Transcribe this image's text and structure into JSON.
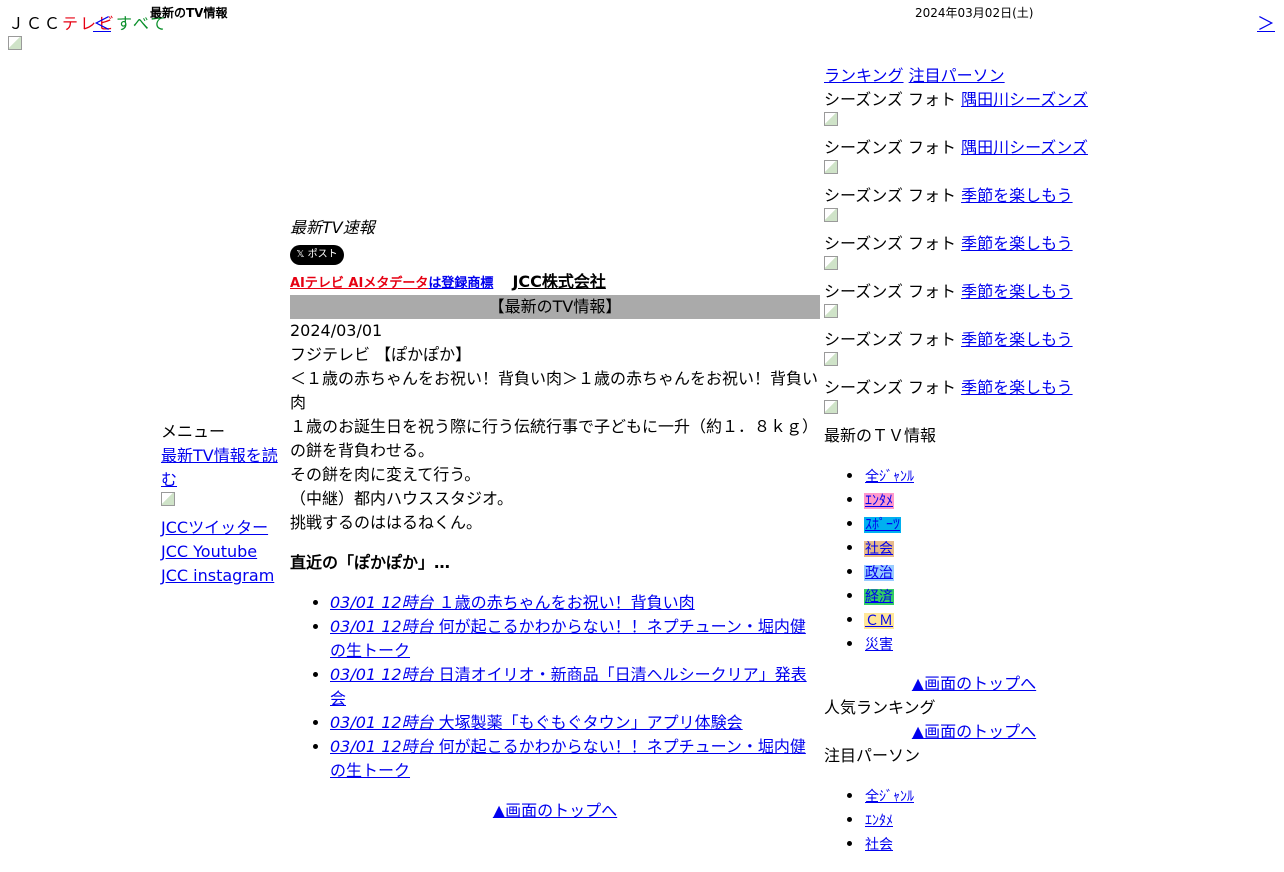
{
  "header": {
    "brand_prefix": "ＪＣＣ",
    "brand_tv": "テレビ",
    "brand_all": "すべて",
    "prev_arrow": "＜",
    "small_title": "最新のTV情報",
    "date": "2024年03月02日(土)",
    "next_arrow": "＞"
  },
  "menu": {
    "title": "メニュー",
    "read_latest": "最新TV情報を読む",
    "twitter": "JCCツイッター",
    "youtube": "JCC Youtube",
    "instagram": "JCC instagram"
  },
  "main": {
    "sokuho": "最新TV速報",
    "tweet": "𝕏 ポスト",
    "registered_red": "AIテレビ AIメタデータ",
    "registered_blue": "は登録商標",
    "company": "JCC株式会社",
    "bar_title": "【最新のTV情報】",
    "date": "2024/03/01",
    "program": "フジテレビ 【ぽかぽか】",
    "headline": "＜１歳の赤ちゃんをお祝い！背負い肉＞１歳の赤ちゃんをお祝い！背負い肉",
    "body1": "１歳のお誕生日を祝う際に行う伝統行事で子どもに一升（約１．８ｋｇ）の餅を背負わせる。",
    "body2": "その餅を肉に変えて行う。",
    "body3": "（中継）都内ハウススタジオ。",
    "body4": "挑戦するのははるねくん。",
    "recent_title": "直近の「ぽかぽか」…",
    "recent": [
      {
        "time": "03/01 12時台",
        "title": " １歳の赤ちゃんをお祝い！背負い肉"
      },
      {
        "time": "03/01 12時台",
        "title": " 何が起こるかわからない！！ネプチューン・堀内健の生トーク"
      },
      {
        "time": "03/01 12時台",
        "title": " 日清オイリオ・新商品「日清ヘルシークリア」発表会"
      },
      {
        "time": "03/01 12時台",
        "title": " 大塚製薬「もぐもぐタウン」アプリ体験会"
      },
      {
        "time": "03/01 12時台",
        "title": " 何が起こるかわからない！！ネプチューン・堀内健の生トーク"
      }
    ],
    "to_top": "▲画面のトップへ"
  },
  "right": {
    "tab_ranking": "ランキング",
    "tab_person": "注目パーソン",
    "photo_prefix": "シーズンズ フォト",
    "photos": [
      "隅田川シーズンズ",
      "隅田川シーズンズ",
      "季節を楽しもう",
      "季節を楽しもう",
      "季節を楽しもう",
      "季節を楽しもう",
      "季節を楽しもう"
    ],
    "latest_title": "最新のＴＶ情報",
    "genres": [
      {
        "label": "全ｼﾞｬﾝﾙ",
        "bg": "#ffffff"
      },
      {
        "label": "ｴﾝﾀﾒ",
        "bg": "#ff99cc"
      },
      {
        "label": "ｽﾎﾟｰﾂ",
        "bg": "#00b0f0"
      },
      {
        "label": "社会",
        "bg": "#e6b98a"
      },
      {
        "label": "政治",
        "bg": "#99ccff"
      },
      {
        "label": "経済",
        "bg": "#33cc66"
      },
      {
        "label": "ＣＭ",
        "bg": "#ffe699"
      },
      {
        "label": "災害",
        "bg": "#ffffff"
      }
    ],
    "to_top": "▲画面のトップへ",
    "popular_ranking": "人気ランキング",
    "to_top2": "▲画面のトップへ",
    "notable_person": "注目パーソン",
    "genres2": [
      {
        "label": "全ｼﾞｬﾝﾙ",
        "bg": "#ffffff"
      },
      {
        "label": "ｴﾝﾀﾒ",
        "bg": "#ffffff"
      },
      {
        "label": "社会",
        "bg": "#ffffff"
      }
    ]
  }
}
